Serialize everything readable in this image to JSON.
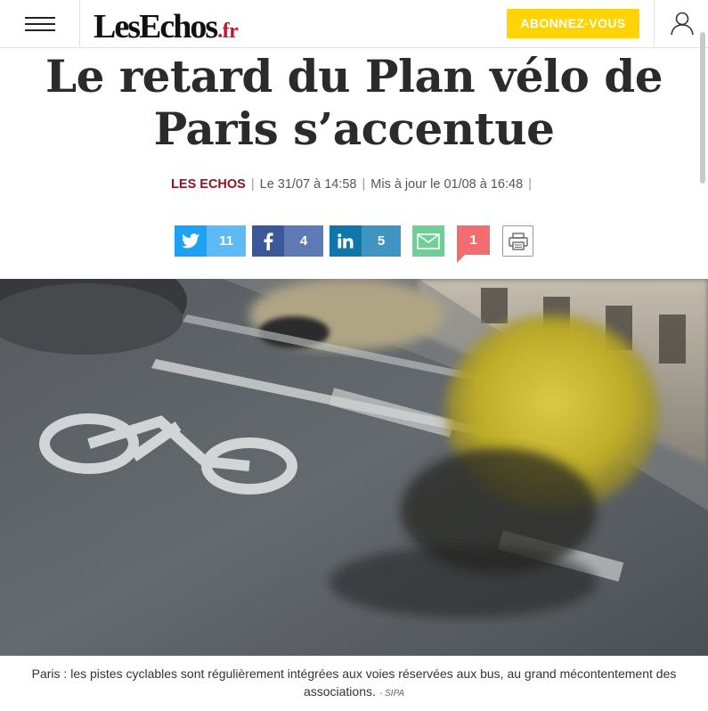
{
  "header": {
    "logo_main": "LesEchos",
    "logo_tld": ".fr",
    "subscribe_label": "ABONNEZ-VOUS"
  },
  "article": {
    "title": "Le retard du Plan vélo de Paris s’accentue",
    "source": "LES ECHOS",
    "published": "Le 31/07 à 14:58",
    "updated": "Mis à jour le 01/08 à 16:48"
  },
  "share": {
    "twitter_count": "11",
    "facebook_count": "4",
    "linkedin_count": "5",
    "comments_count": "1"
  },
  "photo": {
    "caption": "Paris : les pistes cyclables sont régulièrement intégrées aux voies réservées aux bus, au grand mécontentement des associations.",
    "credit": "- SIPA"
  },
  "colors": {
    "accent_yellow": "#ffd400",
    "source_red": "#8b1628",
    "twitter": "#1da1f2",
    "facebook": "#3b5998",
    "linkedin": "#0e76a8",
    "mail": "#6fcf97",
    "comments": "#f26d6d"
  },
  "icons": [
    "menu-icon",
    "user-icon",
    "twitter-icon",
    "facebook-icon",
    "linkedin-icon",
    "mail-icon",
    "comment-icon",
    "print-icon"
  ]
}
